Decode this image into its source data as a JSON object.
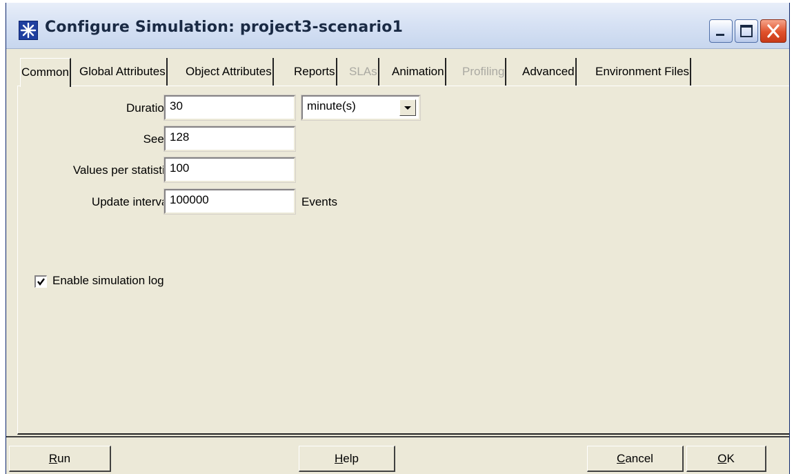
{
  "window": {
    "title": "Configure Simulation: project3-scenario1",
    "controls": [
      "minimize-icon",
      "maximize-icon",
      "close-icon"
    ]
  },
  "tabs": [
    {
      "label": "Common",
      "state": "active"
    },
    {
      "label": "Global Attributes",
      "state": "normal"
    },
    {
      "label": "Object Attributes",
      "state": "normal"
    },
    {
      "label": "Reports",
      "state": "normal"
    },
    {
      "label": "SLAs",
      "state": "disabled"
    },
    {
      "label": "Animation",
      "state": "normal"
    },
    {
      "label": "Profiling",
      "state": "disabled"
    },
    {
      "label": "Advanced",
      "state": "normal"
    },
    {
      "label": "Environment Files",
      "state": "normal"
    }
  ],
  "form": {
    "duration": {
      "label": "Duration:",
      "value": "30",
      "unit": "minute(s)"
    },
    "seed": {
      "label": "Seed:",
      "value": "128"
    },
    "values_per_statistic": {
      "label": "Values per statistic:",
      "value": "100"
    },
    "update_interval": {
      "label": "Update interval:",
      "value": "100000",
      "suffix": "Events"
    },
    "enable_log": {
      "label": "Enable simulation log",
      "checked": true
    }
  },
  "buttons": {
    "run": {
      "mnemonic": "R",
      "rest": "un"
    },
    "help": {
      "mnemonic": "H",
      "rest": "elp"
    },
    "cancel": {
      "mnemonic": "C",
      "rest": "ancel"
    },
    "ok": {
      "mnemonic": "O",
      "rest": "K"
    }
  },
  "colors": {
    "dialog_bg": "#ece9d8",
    "title_text": "#1a2a44",
    "disabled_text": "#aaa9a2",
    "close_button": "#e0512b"
  }
}
